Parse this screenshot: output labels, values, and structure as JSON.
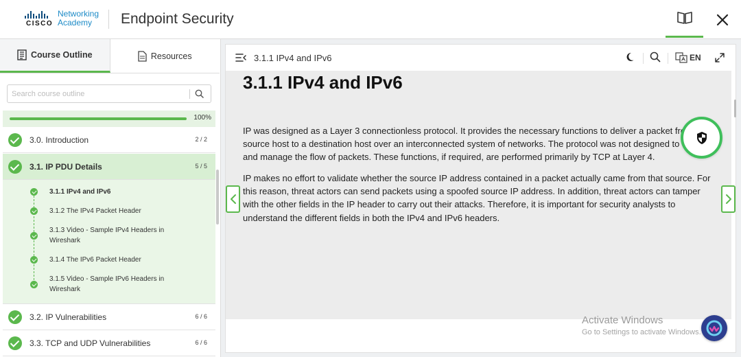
{
  "header": {
    "brand_line1": "Networking",
    "brand_line2": "Academy",
    "brand_cisco": "CISCO",
    "title": "Endpoint Security"
  },
  "sidebar": {
    "tabs": [
      {
        "label": "Course Outline",
        "icon": "outline-icon",
        "active": true
      },
      {
        "label": "Resources",
        "icon": "document-icon",
        "active": false
      }
    ],
    "search_placeholder": "Search course outline",
    "progress": {
      "value": 100,
      "label": "100%"
    },
    "modules": [
      {
        "label": "3.0. Introduction",
        "count": "2 / 2"
      },
      {
        "label": "3.1. IP PDU Details",
        "count": "5 / 5",
        "active": true
      },
      {
        "label": "3.2. IP Vulnerabilities",
        "count": "6 / 6"
      },
      {
        "label": "3.3. TCP and UDP Vulnerabilities",
        "count": "6 / 6"
      }
    ],
    "subitems": [
      {
        "label": "3.1.1 IPv4 and IPv6",
        "active": true
      },
      {
        "label": "3.1.2 The IPv4 Packet Header"
      },
      {
        "label": "3.1.3 Video - Sample IPv4 Headers in Wireshark"
      },
      {
        "label": "3.1.4 The IPv6 Packet Header"
      },
      {
        "label": "3.1.5 Video - Sample IPv6 Headers in Wireshark"
      }
    ]
  },
  "content": {
    "breadcrumb": "3.1.1 IPv4 and IPv6",
    "language": "EN",
    "title": "3.1.1 IPv4 and IPv6",
    "paragraphs": [
      "IP was designed as a Layer 3 connectionless protocol. It provides the necessary functions to deliver a packet from a source host to a destination host over an interconnected system of networks. The protocol was not designed to track and manage the flow of packets. These functions, if required, are performed primarily by TCP at Layer 4.",
      "IP makes no effort to validate whether the source IP address contained in a packet actually came from that source. For this reason, threat actors can send packets using a spoofed source IP address. In addition, threat actors can tamper with the other fields in the IP header to carry out their attacks. Therefore, it is important for security analysts to understand the different fields in both the IPv4 and IPv6 headers."
    ]
  },
  "watermark": {
    "title": "Activate Windows",
    "subtitle": "Go to Settings to activate Windows."
  },
  "colors": {
    "accent": "#5bb84d",
    "shield_ring": "#3fbf5b",
    "assistant": "#2d3e8f"
  }
}
